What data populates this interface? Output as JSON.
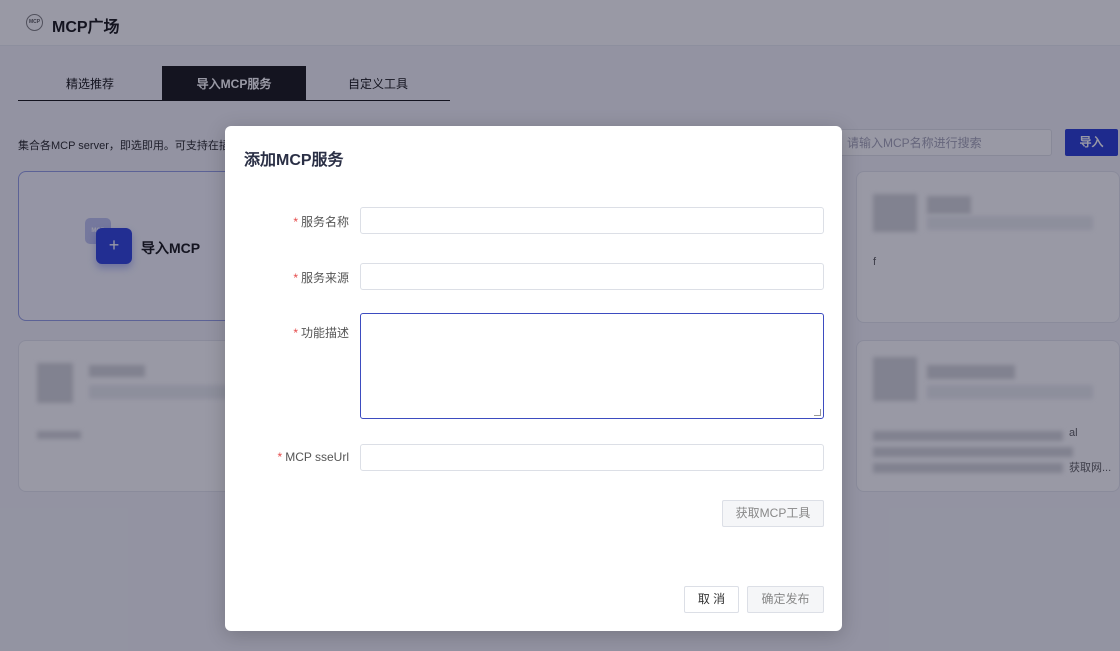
{
  "header": {
    "title": "MCP广场",
    "logo_text": "MCP"
  },
  "tabs": [
    {
      "label": "精选推荐",
      "active": false
    },
    {
      "label": "导入MCP服务",
      "active": true
    },
    {
      "label": "自定义工具",
      "active": false
    }
  ],
  "description": "集合各MCP server，即选即用。可支持在插件",
  "search": {
    "placeholder": "请输入MCP名称进行搜索"
  },
  "import_button": "导入",
  "import_card": {
    "label": "导入MCP",
    "icon_text": "MCP"
  },
  "card_fragments": {
    "c3_text": "f",
    "c4_text_a": "al",
    "c4_text_b": "获取网..."
  },
  "modal": {
    "title": "添加MCP服务",
    "required_mark": "*",
    "fields": [
      {
        "label": "服务名称",
        "value": ""
      },
      {
        "label": "服务来源",
        "value": ""
      },
      {
        "label": "功能描述",
        "value": ""
      },
      {
        "label": "MCP sseUrl",
        "value": ""
      }
    ],
    "fetch_tools_button": "获取MCP工具",
    "cancel_button": "取 消",
    "publish_button": "确定发布"
  },
  "colors": {
    "accent": "#3246d8",
    "required": "#e54a4a",
    "tab_active": "#222222"
  }
}
